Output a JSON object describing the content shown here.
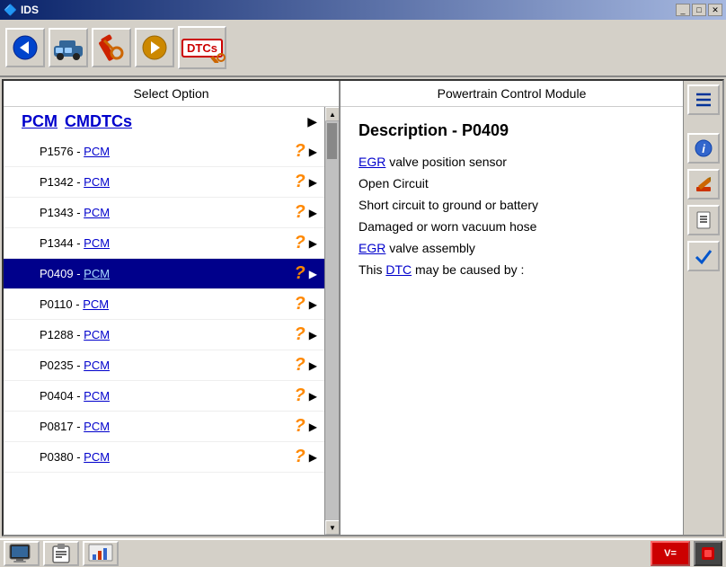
{
  "titleBar": {
    "title": "IDS",
    "controls": {
      "minimize": "_",
      "maximize": "□",
      "close": "✕"
    }
  },
  "toolbar": {
    "buttons": [
      {
        "name": "back-button",
        "icon": "◀",
        "label": "Back",
        "color": "#0044cc"
      },
      {
        "name": "vehicle-button",
        "icon": "🚗",
        "label": "Vehicle"
      },
      {
        "name": "tools-button",
        "icon": "🔧",
        "label": "Tools"
      },
      {
        "name": "forward-button",
        "icon": "▶",
        "label": "Forward",
        "color": "#cc8800"
      }
    ],
    "dtc": {
      "label": "DTCs"
    }
  },
  "leftPanel": {
    "header": "Select Option",
    "headerItem": {
      "code": "PCM",
      "separator": " ",
      "link": "CMDTCs",
      "arrowRight": "▶"
    },
    "items": [
      {
        "code": "P1576",
        "link": "PCM",
        "selected": false
      },
      {
        "code": "P1342",
        "link": "PCM",
        "selected": false
      },
      {
        "code": "P1343",
        "link": "PCM",
        "selected": false
      },
      {
        "code": "P1344",
        "link": "PCM",
        "selected": false
      },
      {
        "code": "P0409",
        "link": "PCM",
        "selected": true
      },
      {
        "code": "P0110",
        "link": "PCM",
        "selected": false
      },
      {
        "code": "P1288",
        "link": "PCM",
        "selected": false
      },
      {
        "code": "P0235",
        "link": "PCM",
        "selected": false
      },
      {
        "code": "P0404",
        "link": "PCM",
        "selected": false
      },
      {
        "code": "P0817",
        "link": "PCM",
        "selected": false
      },
      {
        "code": "P0380",
        "link": "PCM",
        "selected": false
      }
    ],
    "questionMark": "?",
    "arrowRight": "▶"
  },
  "rightPanel": {
    "header": "Powertrain Control Module",
    "descriptionTitle": "Description - P0409",
    "items": [
      {
        "text1": "",
        "link1": "EGR",
        "text2": " valve position sensor",
        "link2": null
      },
      {
        "text1": "Open Circuit",
        "link1": null,
        "text2": null,
        "link2": null
      },
      {
        "text1": "Short circuit to ground or battery",
        "link1": null,
        "text2": null,
        "link2": null
      },
      {
        "text1": "Damaged or worn vacuum hose",
        "link1": null,
        "text2": null,
        "link2": null
      },
      {
        "text1": "",
        "link1": "EGR",
        "text2": " valve assembly",
        "link2": null
      },
      {
        "text1": "This ",
        "link1": "DTC",
        "text2": " may be caused by :",
        "link2": null
      }
    ]
  },
  "sideButtons": {
    "topIcon": "≡",
    "infoIcon": "ℹ",
    "editIcon": "✏",
    "docIcon": "📄",
    "checkIcon": "✔"
  },
  "statusBar": {
    "btn1": "🖥",
    "btn2": "📋",
    "btn3": "📊",
    "rightBtn1": "V=",
    "rightBtn2": "⬛"
  }
}
